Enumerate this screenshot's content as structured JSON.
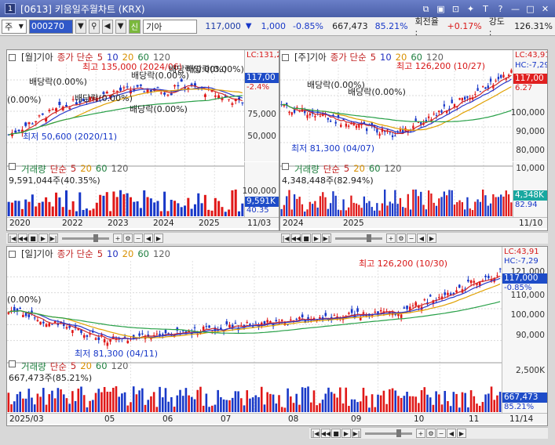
{
  "window": {
    "badge": "1",
    "title": "[0613] 키움일주월차트 (KRX)"
  },
  "toolbar": {
    "market": "주",
    "code": "000270",
    "name": "기아",
    "sin": "신",
    "price": "117,000",
    "change": "1,000",
    "pct": "-0.85%",
    "volume": "667,473",
    "vol_ratio": "85.21%",
    "turnover_label": "회전율 :",
    "turnover": "+0.17%",
    "strength_label": "강도 :",
    "strength": "126.31%"
  },
  "ma_labels": {
    "prefix": "종가 단순",
    "p5": "5",
    "p10": "10",
    "p20": "20",
    "p60": "60",
    "p120": "120"
  },
  "vol_labels": {
    "title": "거래량",
    "prefix": "단순",
    "p5": "5",
    "p20": "20",
    "p60": "60",
    "p120": "120"
  },
  "monthly": {
    "name": "[월]기아",
    "lc": "LC:131,2",
    "price": "117,00",
    "pct": "-2.4%",
    "ticks": [
      "75,000",
      "50,000"
    ],
    "high": "최고 135,000 (2024/06)",
    "low": "최저 50,600 (2020/11)",
    "div": [
      "배당락(0.00%)",
      "배당락(0.00%)",
      "배당락(0.00%)",
      "배당락(0.00%)",
      "배당락(0.00%)",
      "(0.00%)",
      "배당락(0.00%)"
    ],
    "vol_value": "9,591,044주(40.35%)",
    "vol_tick": "100,000",
    "vol_tag": "9,591K",
    "vol_pct": "40.35",
    "x": [
      "2020",
      "2022",
      "2023",
      "2024",
      "2025",
      "11/03"
    ]
  },
  "weekly": {
    "name": "[주]기아",
    "lc": "LC:43,91",
    "hc": "HC:-7,29",
    "price": "117,00",
    "pct": "6.27",
    "ticks": [
      "100,000",
      "90,000",
      "80,000"
    ],
    "high": "최고 126,200 (10/27)",
    "low": "최저 81,300 (04/07)",
    "div": [
      "배당락(0.00%)",
      "배당락(0.00%)"
    ],
    "vol_value": "4,348,448주(82.94%)",
    "vol_tick": "10,000",
    "vol_tag": "4,348K",
    "vol_pct": "82.94",
    "x": [
      "2024",
      "2025",
      "11/10"
    ]
  },
  "daily": {
    "name": "[일]기아",
    "lc": "LC:43,91",
    "hc": "HC:-7,29",
    "tick_top": "121,000",
    "price": "117,000",
    "pct": "-0.85%",
    "tick_sub": "110,000",
    "ticks": [
      "100,000",
      "90,000"
    ],
    "high": "최고 126,200 (10/30)",
    "low": "최저 81,300 (04/11)",
    "div": "(0.00%)",
    "vol_value": "667,473주(85.21%)",
    "vol_tick": "2,500K",
    "vol_tag": "667,473",
    "vol_pct": "85.21%",
    "x": [
      "2025/03",
      "05",
      "06",
      "07",
      "08",
      "09",
      "10",
      "11",
      "11/14"
    ]
  },
  "colors": {
    "up": "#e01818",
    "down": "#1838c8",
    "accent": "#1e4cc8"
  }
}
